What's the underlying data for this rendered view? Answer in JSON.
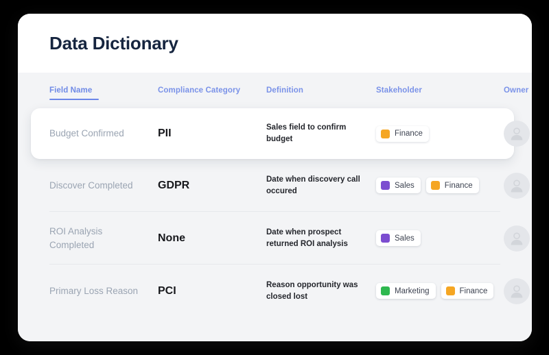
{
  "card": {
    "title": "Data Dictionary"
  },
  "table": {
    "columns": [
      {
        "label": "Field Name",
        "active": true
      },
      {
        "label": "Compliance Category",
        "active": false
      },
      {
        "label": "Definition",
        "active": false
      },
      {
        "label": "Stakeholder",
        "active": false
      },
      {
        "label": "Owner",
        "active": false
      }
    ],
    "rows": [
      {
        "field_name": "Budget Confirmed",
        "compliance_category": "PII",
        "definition": "Sales field to confirm budget",
        "stakeholders": [
          {
            "label": "Finance",
            "color": "#f5a623"
          }
        ],
        "owner": "avatar-placeholder",
        "selected": true
      },
      {
        "field_name": "Discover Completed",
        "compliance_category": "GDPR",
        "definition": "Date when discovery call occured",
        "stakeholders": [
          {
            "label": "Sales",
            "color": "#7c4dd0"
          },
          {
            "label": "Finance",
            "color": "#f5a623"
          }
        ],
        "owner": "avatar-placeholder",
        "selected": false
      },
      {
        "field_name": "ROI Analysis Completed",
        "compliance_category": "None",
        "definition": "Date when prospect returned ROI analysis",
        "stakeholders": [
          {
            "label": "Sales",
            "color": "#7c4dd0"
          }
        ],
        "owner": "avatar-placeholder",
        "selected": false
      },
      {
        "field_name": "Primary Loss Reason",
        "compliance_category": "PCI",
        "definition": "Reason opportunity was closed lost",
        "stakeholders": [
          {
            "label": "Marketing",
            "color": "#2eb84f"
          },
          {
            "label": "Finance",
            "color": "#f5a623"
          }
        ],
        "owner": "avatar-placeholder",
        "selected": false
      }
    ]
  },
  "theme": {
    "page_background": "#000000",
    "card_background": "#ffffff",
    "table_background": "#f3f4f6",
    "title_color": "#16253f",
    "header_link_color": "#7a92e8",
    "field_name_color": "#9aa4b2",
    "category_color": "#17181c",
    "definition_color": "#24262c",
    "avatar_color": "#e4e6ea"
  }
}
